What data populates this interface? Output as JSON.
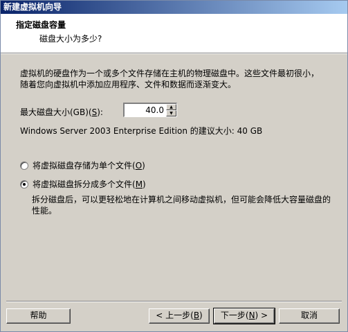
{
  "window": {
    "title": "新建虚拟机向导"
  },
  "header": {
    "title": "指定磁盘容量",
    "subtitle": "磁盘大小为多少?"
  },
  "description": "虚拟机的硬盘作为一个或多个文件存储在主机的物理磁盘中。这些文件最初很小，随着您向虚拟机中添加应用程序、文件和数据而逐渐变大。",
  "disk_size": {
    "label_prefix": "最大磁盘大小(GB)(",
    "label_accel": "S",
    "label_suffix": "):",
    "value": "40.0",
    "up_glyph": "▲",
    "down_glyph": "▼"
  },
  "recommend_text": "Windows Server 2003 Enterprise Edition 的建议大小: 40 GB",
  "options": {
    "single": {
      "prefix": "将虚拟磁盘存储为单个文件(",
      "accel": "O",
      "suffix": ")",
      "selected": false
    },
    "multi": {
      "prefix": "将虚拟磁盘拆分成多个文件(",
      "accel": "M",
      "suffix": ")",
      "selected": true
    }
  },
  "split_description": "拆分磁盘后，可以更轻松地在计算机之间移动虚拟机，但可能会降低大容量磁盘的性能。",
  "buttons": {
    "help": "帮助",
    "back_prefix": "< 上一步(",
    "back_accel": "B",
    "back_suffix": ")",
    "next_prefix": "下一步(",
    "next_accel": "N",
    "next_suffix": ") >",
    "cancel": "取消"
  }
}
